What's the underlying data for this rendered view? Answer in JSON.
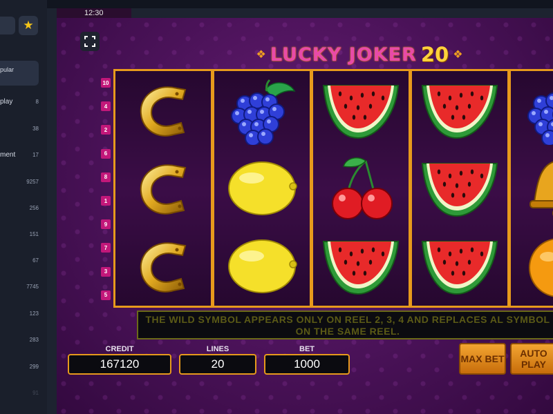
{
  "sidebar": {
    "favorite_icon": "star-icon",
    "popular_label": "pular",
    "items": [
      {
        "label": "play",
        "count": "8"
      },
      {
        "label": "",
        "count": "38"
      },
      {
        "label": "ment",
        "count": "17"
      },
      {
        "label": "",
        "count": "9257"
      },
      {
        "label": "",
        "count": "256"
      },
      {
        "label": "",
        "count": "151"
      },
      {
        "label": "",
        "count": "67"
      },
      {
        "label": "",
        "count": "7745"
      },
      {
        "label": "",
        "count": "123"
      },
      {
        "label": "",
        "count": "283"
      },
      {
        "label": "",
        "count": "299"
      },
      {
        "label": "",
        "count": "91"
      }
    ]
  },
  "status": {
    "time": "12:30"
  },
  "game": {
    "title_part1": "LUCKY JOKER",
    "title_part2": "20",
    "line_numbers": [
      "10",
      "4",
      "2",
      "6",
      "8",
      "1",
      "9",
      "7",
      "3",
      "5"
    ],
    "reels": [
      [
        "horseshoe",
        "horseshoe",
        "horseshoe"
      ],
      [
        "grapes",
        "lemon",
        "lemon"
      ],
      [
        "watermelon",
        "cherry",
        "watermelon"
      ],
      [
        "watermelon",
        "watermelon",
        "watermelon"
      ],
      [
        "grapes",
        "bell",
        "orange"
      ]
    ],
    "info_text": "THE WILD SYMBOL APPEARS ONLY ON REEL 2, 3, 4 AND REPLACES AL SYMBOL ON THE SAME REEL.",
    "credit_label": "CREDIT",
    "credit_value": "167120",
    "lines_label": "LINES",
    "lines_value": "20",
    "bet_label": "BET",
    "bet_value": "1000",
    "max_bet_label": "MAX BET",
    "auto_play_label": "AUTO PLAY"
  },
  "colors": {
    "frame": "#e79a1c",
    "title_pink": "#e84aa8",
    "title_gold": "#ffd23a",
    "line_marker": "#c2187a"
  }
}
